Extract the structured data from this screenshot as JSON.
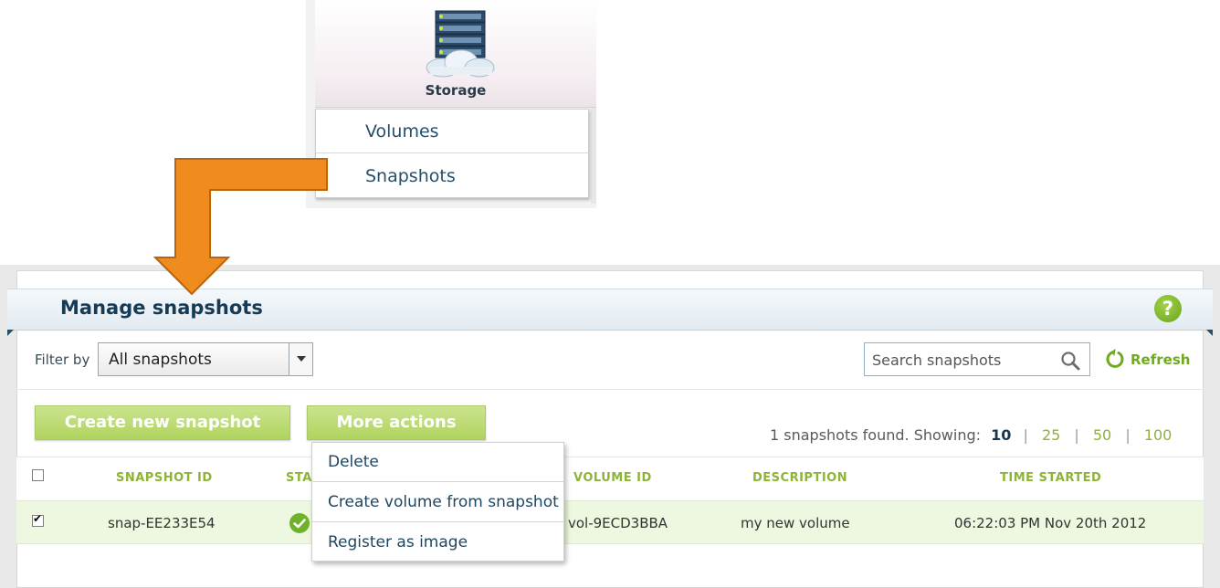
{
  "storage_menu": {
    "title": "Storage",
    "items": [
      {
        "label": "Volumes"
      },
      {
        "label": "Snapshots"
      }
    ]
  },
  "page": {
    "title": "Manage snapshots",
    "help_label": "?"
  },
  "filter": {
    "label": "Filter by",
    "selected": "All snapshots"
  },
  "search": {
    "placeholder": "Search snapshots"
  },
  "refresh": {
    "label": "Refresh"
  },
  "buttons": {
    "create": "Create new snapshot",
    "more": "More actions"
  },
  "paging": {
    "summary": "1 snapshots found. Showing:",
    "current": "10",
    "options": [
      "25",
      "50",
      "100"
    ]
  },
  "table": {
    "columns": [
      "SNAPSHOT ID",
      "STA",
      "VOLUME ID",
      "DESCRIPTION",
      "TIME STARTED"
    ],
    "rows": [
      {
        "checked": true,
        "snapshot_id": "snap-EE233E54",
        "status": "completed",
        "volume_id": "vol-9ECD3BBA",
        "description": "my new volume",
        "time_started": "06:22:03 PM Nov 20th 2012"
      }
    ]
  },
  "more_actions_menu": {
    "items": [
      "Delete",
      "Create volume from snapshot",
      "Register as image"
    ]
  },
  "colors": {
    "accent_green": "#8db337",
    "button_green": "#b0d35f",
    "title_navy": "#173a55",
    "arrow_orange": "#f08c1e"
  },
  "icons": [
    "storage-server-icon",
    "help-icon",
    "search-icon",
    "refresh-icon",
    "check-circle-icon",
    "dropdown-caret-icon"
  ]
}
